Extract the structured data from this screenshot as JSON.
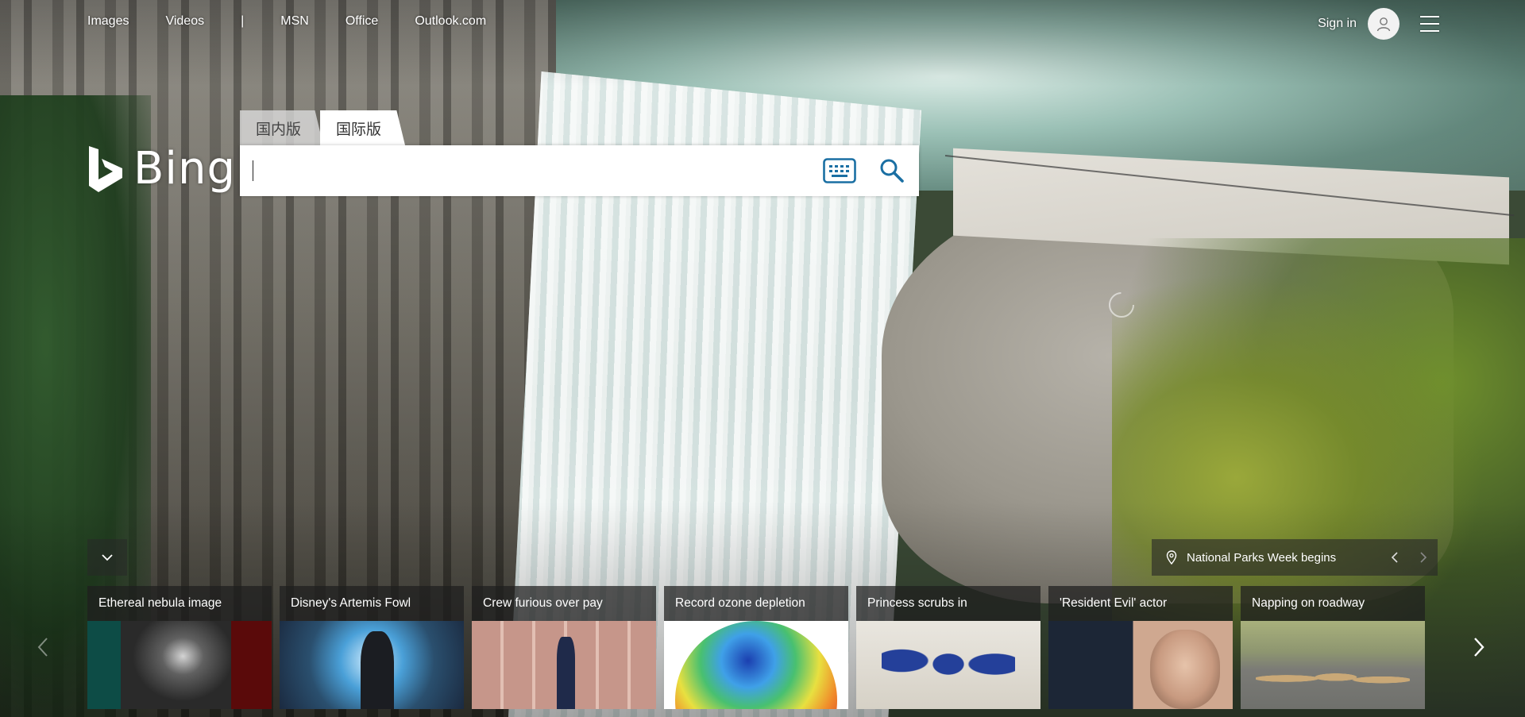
{
  "nav": {
    "links": [
      "Images",
      "Videos"
    ],
    "separator": "|",
    "links2": [
      "MSN",
      "Office",
      "Outlook.com"
    ]
  },
  "header": {
    "signin": "Sign in"
  },
  "logo": {
    "text": "Bing"
  },
  "search": {
    "tabs": [
      "国内版",
      "国际版"
    ],
    "active_tab": "国际版",
    "value": "",
    "placeholder": ""
  },
  "info": {
    "label": "National Parks Week begins"
  },
  "cards": [
    {
      "title": "Ethereal nebula image"
    },
    {
      "title": "Disney's Artemis Fowl"
    },
    {
      "title": "Crew furious over pay"
    },
    {
      "title": "Record ozone depletion"
    },
    {
      "title": "Princess scrubs in"
    },
    {
      "title": "'Resident Evil' actor"
    },
    {
      "title": "Napping on roadway"
    }
  ],
  "icons": {
    "avatar": "person-icon",
    "menu": "hamburger-menu-icon",
    "keyboard": "keyboard-icon",
    "search": "search-icon",
    "location": "location-pin-icon",
    "collapse": "chevron-down-icon"
  },
  "colors": {
    "accent": "#1a6fa3",
    "overlay": "rgba(30,30,30,0.72)"
  }
}
